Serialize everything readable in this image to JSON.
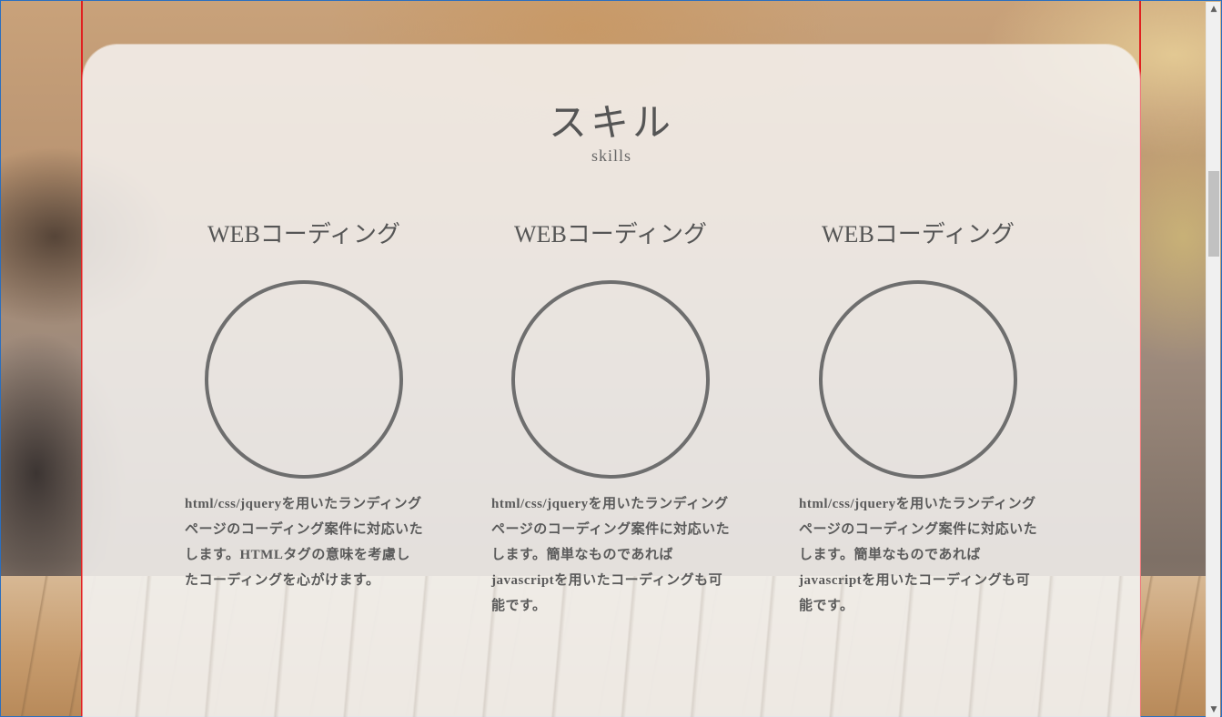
{
  "section": {
    "title": "スキル",
    "subtitle": "skills"
  },
  "skills": [
    {
      "title": "WEBコーディング",
      "description": "html/css/jqueryを用いたランディングページのコーディング案件に対応いたします。HTMLタグの意味を考慮したコーディングを心がけます。"
    },
    {
      "title": "WEBコーディング",
      "description": "html/css/jqueryを用いたランディングページのコーディング案件に対応いたします。簡単なものであればjavascriptを用いたコーディングも可能です。"
    },
    {
      "title": "WEBコーディング",
      "description": "html/css/jqueryを用いたランディングページのコーディング案件に対応いたします。簡単なものであればjavascriptを用いたコーディングも可能です。"
    }
  ],
  "icons": {
    "scroll_up": "scroll-up-arrow-icon",
    "scroll_down": "scroll-down-arrow-icon"
  },
  "colors": {
    "guide_line": "#e02020",
    "text": "#555555",
    "circle_stroke": "#6e6e6e"
  }
}
